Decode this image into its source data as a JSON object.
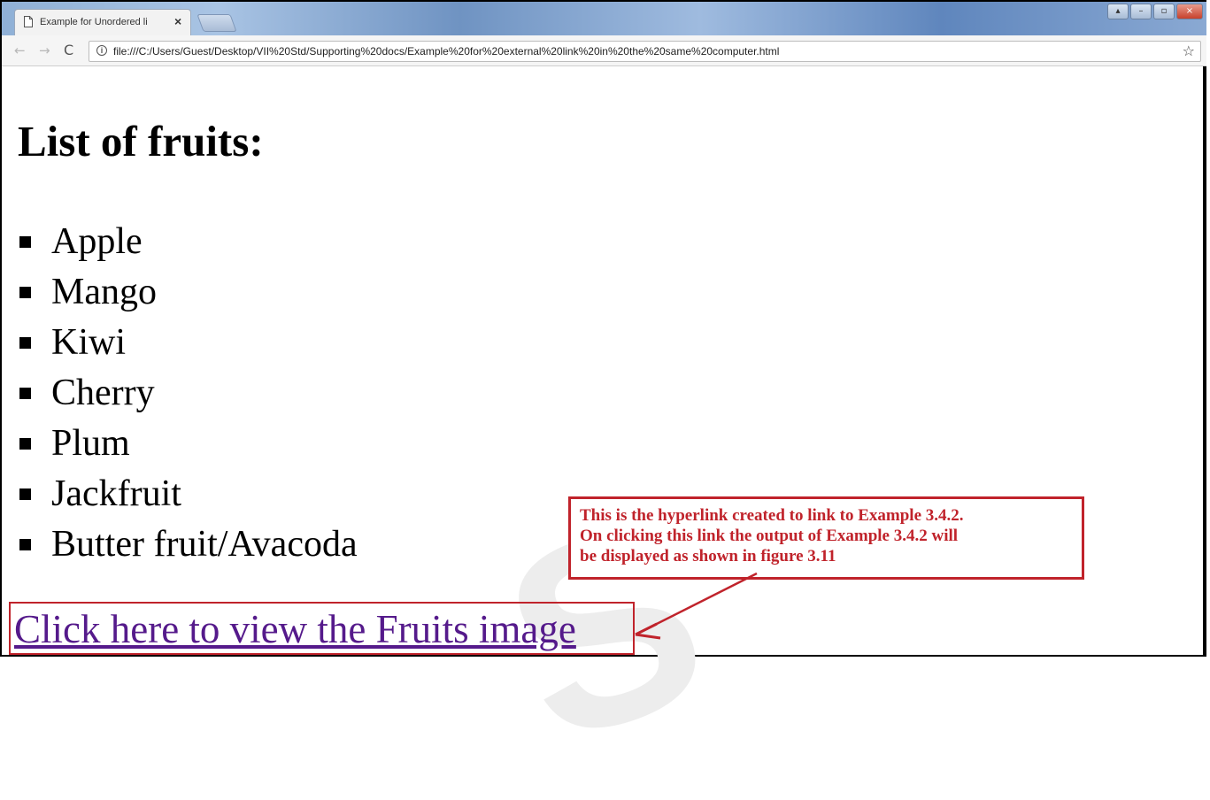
{
  "browser": {
    "tab_title": "Example for Unordered li",
    "tab_close": "×",
    "url": "file:///C:/Users/Guest/Desktop/VII%20Std/Supporting%20docs/Example%20for%20external%20link%20in%20the%20same%20computer.html",
    "info_glyph": "i",
    "back_glyph": "←",
    "forward_glyph": "→",
    "reload_glyph": "C",
    "star_glyph": "☆",
    "minimize_glyph": "–",
    "maximize_glyph": "▫",
    "close_glyph": "×",
    "user_glyph": "▴"
  },
  "page": {
    "heading": "List of fruits:",
    "fruits": [
      "Apple",
      "Mango",
      "Kiwi",
      "Cherry",
      "Plum",
      "Jackfruit",
      "Butter fruit/Avacoda"
    ],
    "link_text": "Click here to view the Fruits image"
  },
  "annotation": {
    "line1": "This is the hyperlink created to link to Example 3.4.2.",
    "line2": "On clicking this link the output of Example 3.4.2 will",
    "line3": "be displayed as shown in figure 3.11"
  },
  "watermark": "S",
  "colors": {
    "link": "#551a8b",
    "annotation_red": "#c0232b"
  }
}
